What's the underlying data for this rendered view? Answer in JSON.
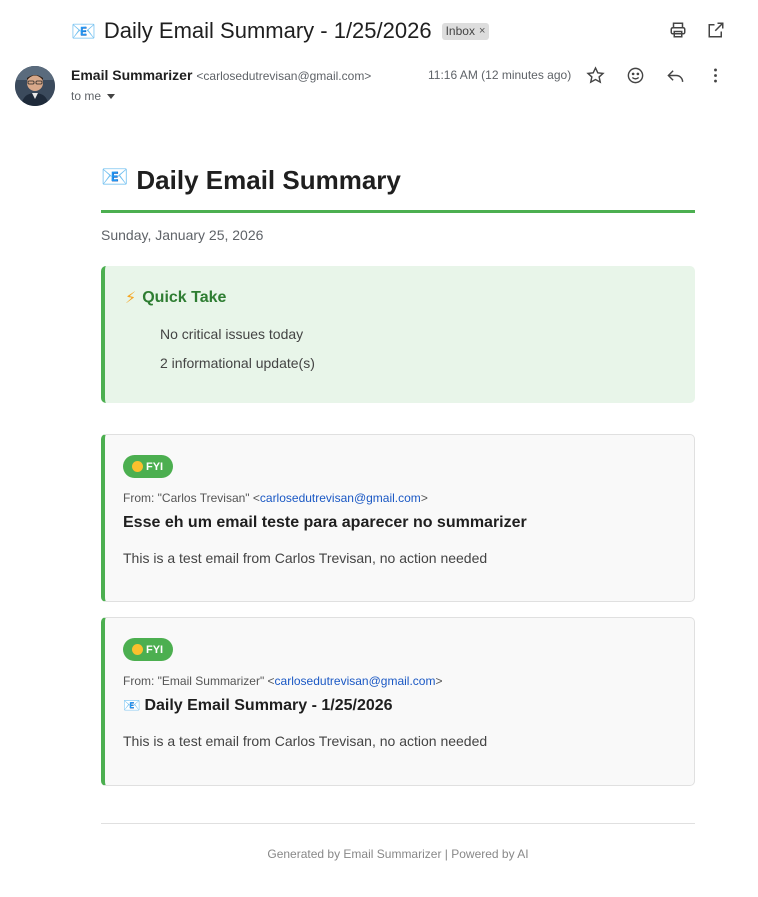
{
  "header": {
    "subject_icon": "📧",
    "subject": "Daily Email Summary - 1/25/2026",
    "label": "Inbox",
    "label_close": "×",
    "icons": [
      "print-icon",
      "open-in-new-window-icon"
    ]
  },
  "message": {
    "sender_name": "Email Summarizer",
    "sender_email": "<carlosedutrevisan@gmail.com>",
    "recipient": "to me",
    "time": "11:16 AM (12 minutes ago)",
    "actions": [
      "star-icon",
      "emoji-icon",
      "reply-icon",
      "more-options-icon"
    ]
  },
  "summary": {
    "title_icon": "📧",
    "title": "Daily Email Summary",
    "date": "Sunday, January 25, 2026",
    "quick_take": {
      "icon": "⚡",
      "title": "Quick Take",
      "items": [
        "No critical issues today",
        "2 informational update(s)"
      ]
    },
    "cards": [
      {
        "badge": "FYI",
        "from_prefix": "From: \"Carlos Trevisan\" <",
        "from_email": "carlosedutrevisan@gmail.com",
        "from_suffix": ">",
        "subject_icon": "",
        "subject": "Esse eh um email teste para aparecer no summarizer",
        "body": "This is a test email from Carlos Trevisan, no action needed"
      },
      {
        "badge": "FYI",
        "from_prefix": "From: \"Email Summarizer\" <",
        "from_email": "carlosedutrevisan@gmail.com",
        "from_suffix": ">",
        "subject_icon": "📧",
        "subject": "Daily Email Summary - 1/25/2026",
        "body": "This is a test email from Carlos Trevisan, no action needed"
      }
    ],
    "footer": "Generated by Email Summarizer | Powered by AI"
  },
  "colors": {
    "accent_green": "#4caf50",
    "quick_bg": "#e8f5e9",
    "quick_title": "#2e7d32",
    "link": "#1a58c4"
  }
}
